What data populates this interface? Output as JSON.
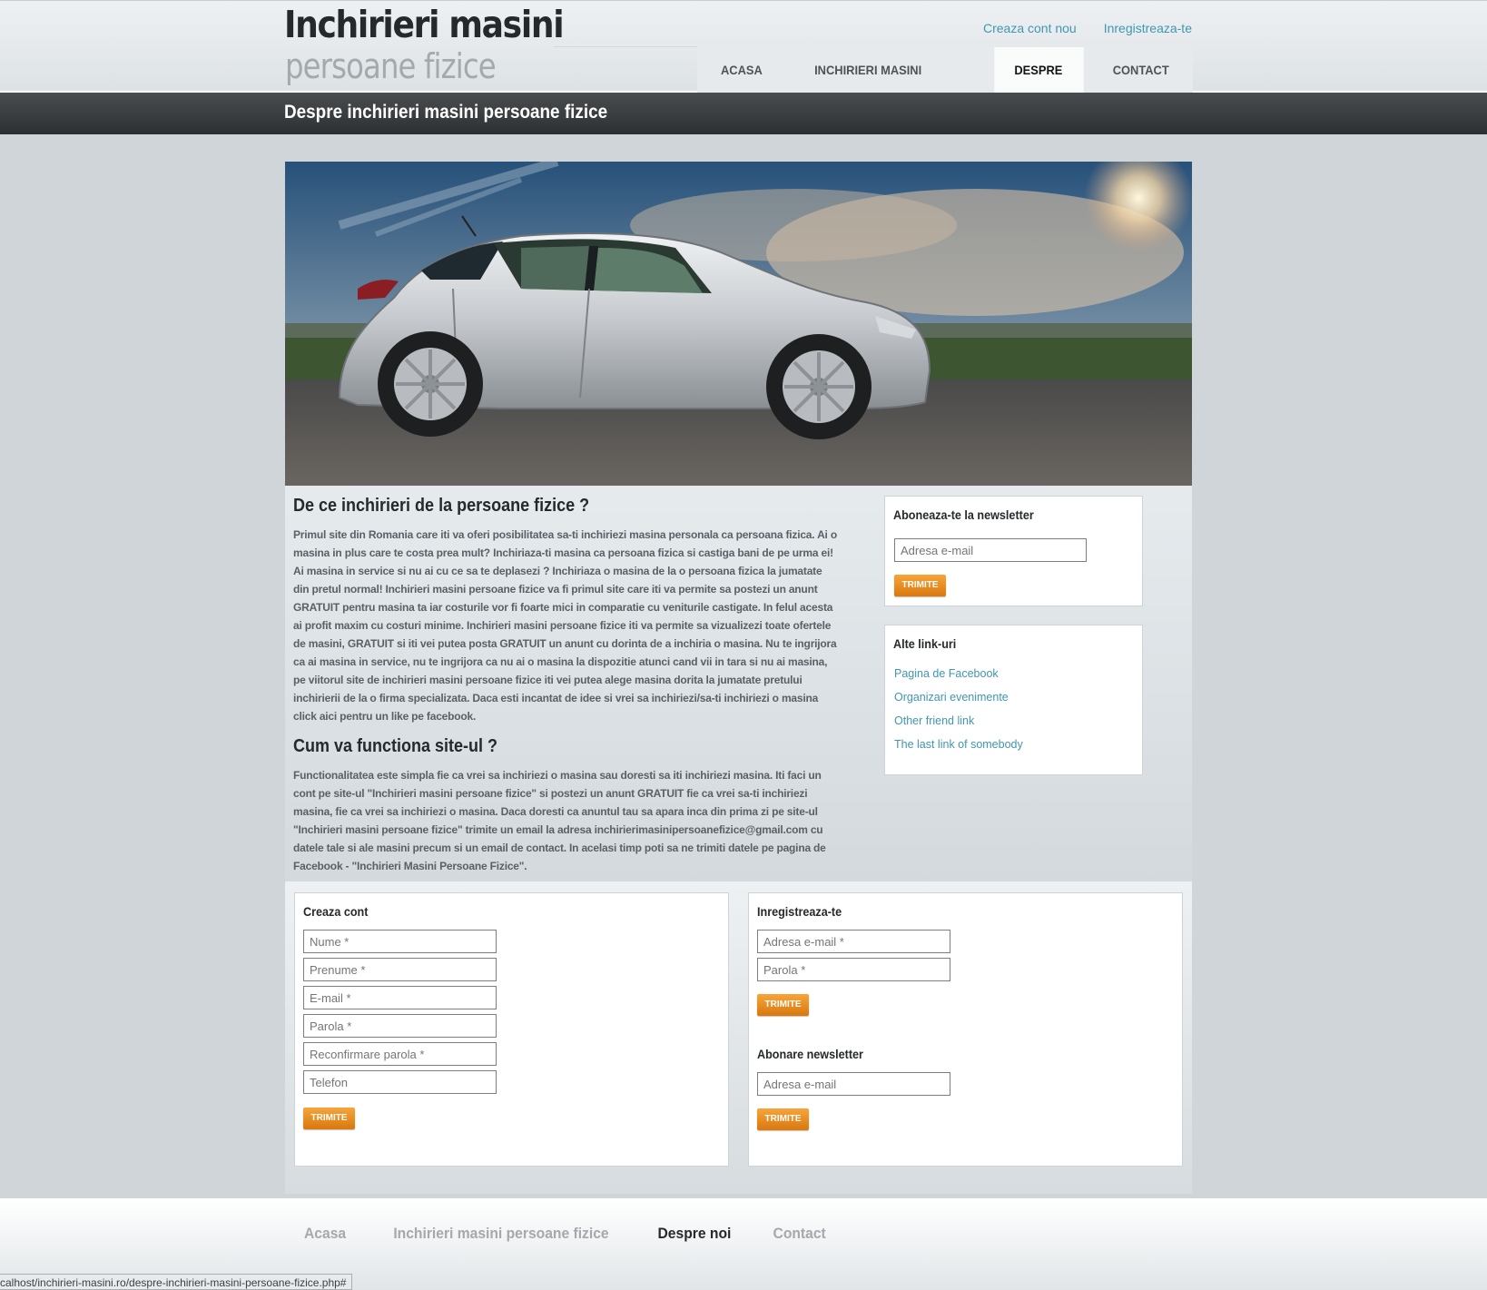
{
  "header": {
    "logo_main": "Inchirieri masini",
    "logo_sub": "persoane fizice",
    "top_links": [
      "Creaza cont nou",
      "Inregistreaza-te"
    ],
    "nav": [
      "ACASA",
      "INCHIRIERI MASINI PERSOANE FIZICE",
      "DESPRE NOI",
      "CONTACT"
    ],
    "active_nav": "DESPRE NOI"
  },
  "page_title": "Despre inchirieri masini persoane fizice",
  "main": {
    "heading1": "De ce inchirieri de la persoane fizice ?",
    "para1": "Primul site din Romania care iti va oferi posibilitatea sa-ti inchiriezi masina personala ca persoana fizica. Ai o masina in plus care te costa prea mult? Inchiriaza-ti masina ca persoana fizica si castiga bani de pe urma ei! Ai masina in service si nu ai cu ce sa te deplasezi ? Inchiriaza o masina de la o persoana fizica la jumatate din pretul normal! Inchirieri masini persoane fizice va fi primul site care iti va permite sa postezi un anunt GRATUIT pentru masina ta iar costurile vor fi foarte mici in comparatie cu veniturile castigate. In felul acesta ai profit maxim cu costuri minime. Inchirieri masini persoane fizice iti va permite sa vizualizezi toate ofertele de masini, GRATUIT si iti vei putea posta GRATUIT un anunt cu dorinta de a inchiria o masina. Nu te ingrijora ca ai masina in service, nu te ingrijora ca nu ai o masina la dispozitie atunci cand vii in tara si nu ai masina, pe viitorul site de inchirieri masini persoane fizice iti vei putea alege masina dorita la jumatate pretului inchirierii de la o firma specializata. Daca esti incantat de idee si vrei sa inchiriezi/sa-ti inchiriezi o masina click aici pentru un like pe facebook.",
    "heading2": "Cum va functiona site-ul ?",
    "para2": "Functionalitatea este simpla fie ca vrei sa inchiriezi o masina sau doresti sa iti inchiriezi masina. Iti faci un cont pe site-ul \"Inchirieri masini persoane fizice\" si postezi un anunt GRATUIT fie ca vrei sa-ti inchiriezi masina, fie ca vrei sa inchiriezi o masina. Daca doresti ca anuntul tau sa apara inca din prima zi pe site-ul \"Inchirieri masini persoane fizice\" trimite un email la adresa inchirierimasinipersoanefizice@gmail.com cu datele tale si ale masini precum si un email de contact. In acelasi timp poti sa ne trimiti datele pe pagina de Facebook - \"Inchirieri Masini Persoane Fizice\"."
  },
  "sidebar": {
    "newsletter_title": "Aboneaza-te la newsletter",
    "newsletter_placeholder": "Adresa e-mail",
    "newsletter_button": "TRIMITE",
    "links_title": "Alte link-uri",
    "links": [
      "Pagina de Facebook",
      "Organizari evenimente",
      "Other friend link",
      "The last link of somebody"
    ]
  },
  "forms": {
    "create": {
      "title": "Creaza cont",
      "fields": [
        "Nume *",
        "Prenume *",
        "E-mail *",
        "Parola *",
        "Reconfirmare parola *",
        "Telefon"
      ],
      "button": "TRIMITE"
    },
    "register": {
      "title": "Inregistreaza-te",
      "fields": [
        "Adresa e-mail *",
        "Parola *"
      ],
      "button": "TRIMITE"
    },
    "newsletter": {
      "title": "Abonare newsletter",
      "placeholder": "Adresa e-mail",
      "button": "TRIMITE"
    }
  },
  "footer": {
    "nav": [
      "Acasa",
      "Inchirieri masini persoane fizice",
      "Despre noi",
      "Contact"
    ]
  },
  "statusbar": "calhost/inchirieri-masini.ro/despre-inchirieri-masini-persoane-fizice.php#"
}
